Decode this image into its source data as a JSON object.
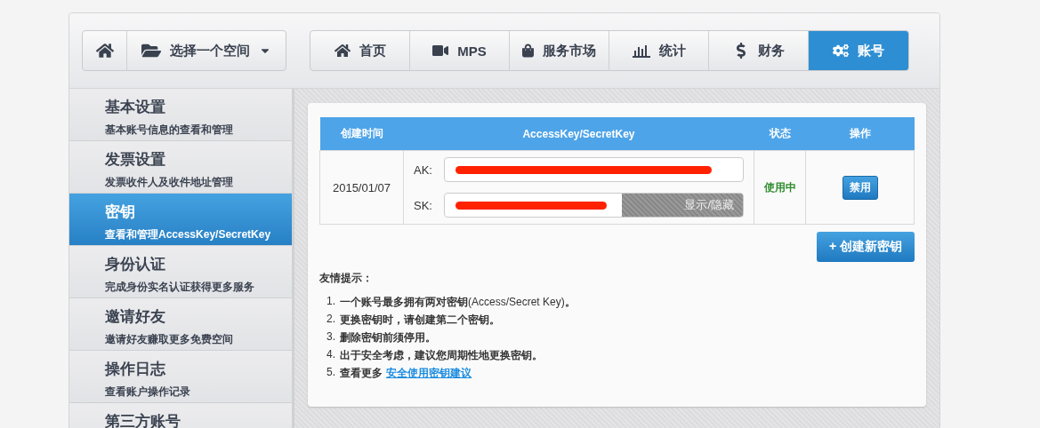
{
  "space_switcher": {
    "label": "选择一个空间"
  },
  "nav_tabs": [
    {
      "label": "首页",
      "selected": false
    },
    {
      "label": "MPS",
      "selected": false
    },
    {
      "label": "服务市场",
      "selected": false
    },
    {
      "label": "统计",
      "selected": false
    },
    {
      "label": "财务",
      "selected": false
    },
    {
      "label": "账号",
      "selected": true
    }
  ],
  "sidebar": {
    "items": [
      {
        "title": "基本设置",
        "subtitle": "基本账号信息的查看和管理",
        "selected": false
      },
      {
        "title": "发票设置",
        "subtitle": "发票收件人及收件地址管理",
        "selected": false
      },
      {
        "title": "密钥",
        "subtitle": "查看和管理AccessKey/SecretKey",
        "selected": true
      },
      {
        "title": "身份认证",
        "subtitle": "完成身份实名认证获得更多服务",
        "selected": false
      },
      {
        "title": "邀请好友",
        "subtitle": "邀请好友赚取更多免费空间",
        "selected": false
      },
      {
        "title": "操作日志",
        "subtitle": "查看账户操作记录",
        "selected": false
      },
      {
        "title": "第三方账号",
        "selected": false
      }
    ]
  },
  "key_table": {
    "columns": [
      "创建时间",
      "AccessKey/SecretKey",
      "状态",
      "操作"
    ],
    "rows": [
      {
        "created": "2015/01/07",
        "ak_label": "AK:",
        "sk_label": "SK:",
        "toggle": "显示/隐藏",
        "status": "使用中",
        "action": "禁用"
      }
    ]
  },
  "create_button": "+ 创建新密钥",
  "tips": {
    "title": "友情提示：",
    "items": [
      {
        "number": "1.",
        "text": "**一个账号最多拥有两对密钥**(Access/Secret Key)**。**"
      },
      {
        "number": "2.",
        "text": "**更换密钥时，请创建第二个密钥。**"
      },
      {
        "number": "3.",
        "text": "**删除密钥前须停用。**"
      },
      {
        "number": "4.",
        "text": "**出于安全考虑，建议您周期性地更换密钥。**"
      },
      {
        "number": "5.",
        "text": "**查看更多**",
        "link": "安全使用密钥建议"
      }
    ]
  }
}
